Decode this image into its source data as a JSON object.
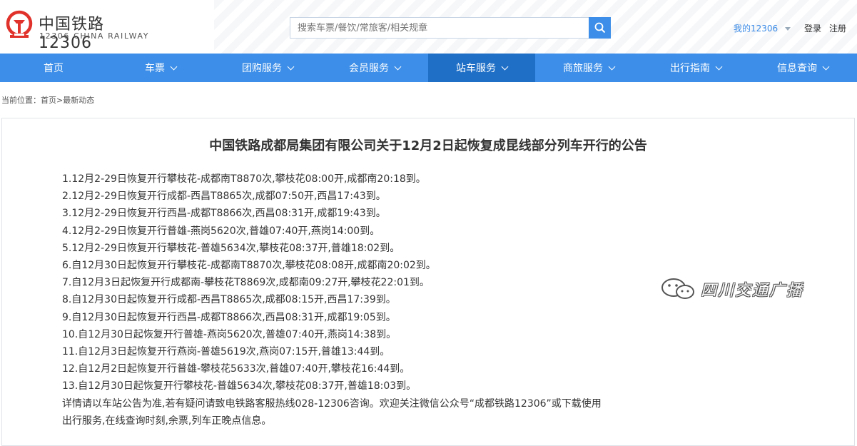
{
  "logo": {
    "cn": "中国铁路12306",
    "en": "12306 CHINA RAILWAY"
  },
  "search": {
    "placeholder": "搜索车票/餐饮/常旅客/相关规章"
  },
  "top_links": {
    "my12306": "我的12306",
    "login": "登录",
    "register": "注册"
  },
  "nav": [
    {
      "label": "首页"
    },
    {
      "label": "车票"
    },
    {
      "label": "团购服务"
    },
    {
      "label": "会员服务"
    },
    {
      "label": "站车服务"
    },
    {
      "label": "商旅服务"
    },
    {
      "label": "出行指南"
    },
    {
      "label": "信息查询"
    }
  ],
  "breadcrumb": {
    "prefix": "当前位置：",
    "home": "首页",
    "sep": ">",
    "current": "最新动态"
  },
  "article": {
    "title": "中国铁路成都局集团有限公司关于12月2日起恢复成昆线部分列车开行的公告",
    "lines": [
      "1.12月2-29日恢复开行攀枝花-成都南T8870次,攀枝花08:00开,成都南20:18到。",
      "2.12月2-29日恢复开行成都-西昌T8865次,成都07:50开,西昌17:43到。",
      "3.12月2-29日恢复开行西昌-成都T8866次,西昌08:31开,成都19:43到。",
      "4.12月2-29日恢复开行普雄-燕岗5620次,普雄07:40开,燕岗14:00到。",
      "5.12月2-29日恢复开行攀枝花-普雄5634次,攀枝花08:37开,普雄18:02到。",
      "6.自12月30日起恢复开行攀枝花-成都南T8870次,攀枝花08:08开,成都南20:02到。",
      "7.自12月3日起恢复开行成都南-攀枝花T8869次,成都南09:27开,攀枝花22:01到。",
      "8.自12月30日起恢复开行成都-西昌T8865次,成都08:15开,西昌17:39到。",
      "9.自12月30日起恢复开行西昌-成都T8866次,西昌08:31开,成都19:05到。",
      "10.自12月30日起恢复开行普雄-燕岗5620次,普雄07:40开,燕岗14:38到。",
      "11.自12月3日起恢复开行燕岗-普雄5619次,燕岗07:15开,普雄13:44到。",
      "12.自12月2日起恢复开行普雄-攀枝花5633次,普雄07:40开,攀枝花16:44到。",
      "13.自12月30日起恢复开行攀枝花-普雄5634次,攀枝花08:37开,普雄18:03到。",
      "详情请以车站公告为准,若有疑问请致电铁路客服热线028-12306咨询。欢迎关注微信公众号“成都铁路12306”或下载使用",
      "出行服务,在线查询时刻,余票,列车正晚点信息。"
    ]
  },
  "watermark": {
    "text": "四川交通广播"
  },
  "colors": {
    "nav_bg": "#3c8ee8",
    "nav_active": "#1f6fc7",
    "logo_red": "#e0322b",
    "link_blue": "#3b8be6"
  }
}
